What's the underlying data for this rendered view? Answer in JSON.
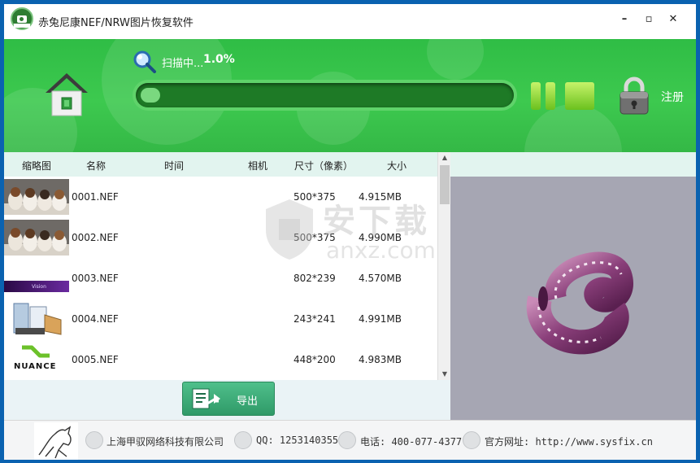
{
  "window": {
    "title": "赤兔尼康NEF/NRW图片恢复软件",
    "minimize": "–",
    "maximize": "▫",
    "close": "✕"
  },
  "header": {
    "home_icon": "home-icon",
    "scan_icon": "search-icon",
    "scan_label": "扫描中...",
    "scan_percent": "1.0%",
    "progress": 0.01,
    "pause_icon": "pause-icon",
    "lock_icon": "lock-icon",
    "register_label": "注册"
  },
  "table": {
    "columns": [
      "缩略图",
      "名称",
      "时间",
      "相机",
      "尺寸（像素）",
      "大小"
    ],
    "rows": [
      {
        "name": "0001.NEF",
        "time": "",
        "camera": "",
        "dims": "500*375",
        "size": "4.915MB",
        "thumb": "puppies"
      },
      {
        "name": "0002.NEF",
        "time": "",
        "camera": "",
        "dims": "500*375",
        "size": "4.990MB",
        "thumb": "puppies"
      },
      {
        "name": "0003.NEF",
        "time": "",
        "camera": "",
        "dims": "802*239",
        "size": "4.570MB",
        "thumb": "purple-banner"
      },
      {
        "name": "0004.NEF",
        "time": "",
        "camera": "",
        "dims": "243*241",
        "size": "4.991MB",
        "thumb": "scanner"
      },
      {
        "name": "0005.NEF",
        "time": "",
        "camera": "",
        "dims": "448*200",
        "size": "4.983MB",
        "thumb": "nuance-logo"
      }
    ],
    "thumb_text": {
      "banner": "Vision",
      "nuance": "NUANCE"
    }
  },
  "export": {
    "label": "导出",
    "icon": "export-icon"
  },
  "preview": {
    "icon": "film-reel-icon"
  },
  "watermark": {
    "zh": "安下载",
    "en": "anxz.com"
  },
  "footer": {
    "company": "上海甲驭网络科技有限公司",
    "qq": "QQ: 1253140355",
    "phone": "电话: 400-077-4377",
    "website": "官方网址: http://www.sysfix.cn"
  },
  "colors": {
    "header_green": "#3dc94f",
    "progress_track": "#1e7a26",
    "export_green": "#3aa876",
    "preview_bg": "#a6a6b3"
  }
}
